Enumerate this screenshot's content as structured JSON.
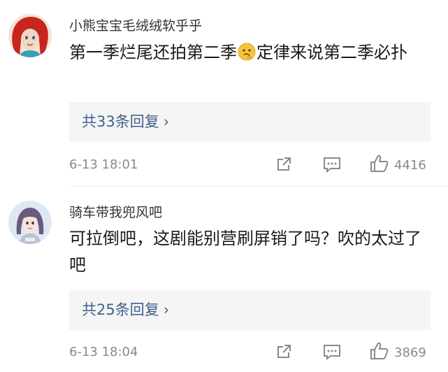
{
  "comments": [
    {
      "username": "小熊宝宝毛绒绒软乎乎",
      "text_before_emoji": "第一季烂尾还拍第二季",
      "emoji": "thinking-face-emoji",
      "text_after_emoji": "定律来说第二季必扑",
      "replies_label": "共33条回复",
      "timestamp": "6-13 18:01",
      "likes": "4416"
    },
    {
      "username": "骑车带我兜风吧",
      "text": "可拉倒吧，这剧能别营刷屏销了吗？吹的太过了吧",
      "replies_label": "共25条回复",
      "timestamp": "6-13 18:04",
      "likes": "3869"
    }
  ],
  "icons": {
    "share": "share-icon",
    "comment": "comment-icon",
    "like": "thumbs-up-icon",
    "reply_chevron": "chevron-right-icon"
  },
  "colors": {
    "link": "#40608f",
    "meta": "#8a8a8a",
    "reply_bg": "#f5f5f5"
  }
}
